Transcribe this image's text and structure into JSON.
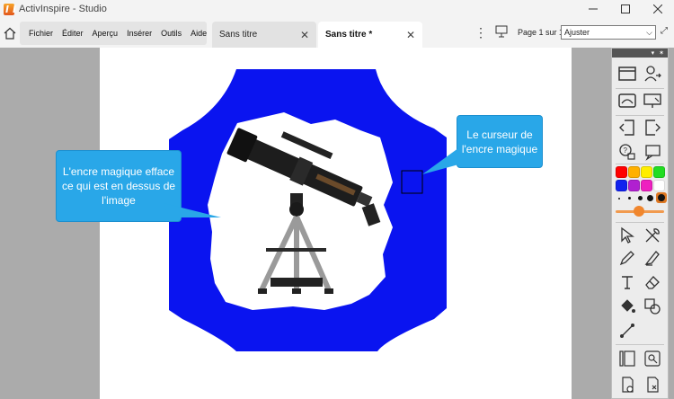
{
  "window": {
    "title": "ActivInspire - Studio",
    "controls": [
      "minimize-icon",
      "maximize-icon",
      "close-icon"
    ]
  },
  "menu": {
    "items": [
      {
        "label": "Fichier"
      },
      {
        "label": "Éditer"
      },
      {
        "label": "Aperçu"
      },
      {
        "label": "Insérer"
      },
      {
        "label": "Outils"
      },
      {
        "label": "Aide"
      }
    ]
  },
  "tabs": [
    {
      "label": "Sans titre",
      "active": false
    },
    {
      "label": "Sans titre *",
      "active": true
    }
  ],
  "page_nav": {
    "page_info": "Page 1 sur 1",
    "zoom": "Ajuster"
  },
  "annotations": {
    "left": "L'encre magique efface ce qui est en dessus de l'image",
    "right": "Le curseur de l'encre magique"
  },
  "canvas": {
    "ink_color": "#0a14f0",
    "image": "telescope",
    "callout_color": "#29a7e8"
  },
  "toolbox": {
    "palette": [
      "#ff0000",
      "#ffb000",
      "#ffee00",
      "#22dd22",
      "#1122ee",
      "#b020d0",
      "#ee20c0",
      "#ffffff",
      "#000000",
      "#1a1a1a",
      "#dd7722"
    ],
    "pen_size": 0.45,
    "tools": [
      "browser-icon",
      "user-switch-icon",
      "flipchart-icon",
      "desktop-icon",
      "previous-page-icon",
      "next-page-icon",
      "voting-icon",
      "message-icon",
      "select-icon",
      "tools-icon",
      "pen-icon",
      "highlighter-icon",
      "text-icon",
      "eraser-icon",
      "fill-icon",
      "shapes-icon",
      "connector-icon",
      "page-view-icon",
      "search-icon",
      "reset-page-icon",
      "clear-icon"
    ]
  }
}
